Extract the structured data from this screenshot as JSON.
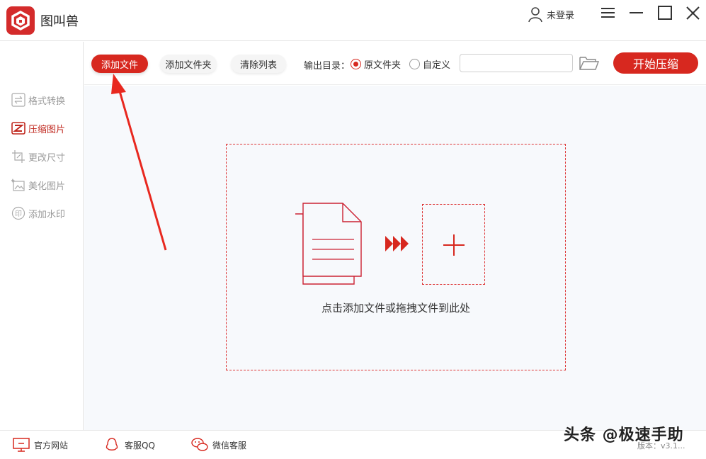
{
  "app": {
    "title": "图叫兽",
    "login_label": "未登录"
  },
  "sidebar": {
    "items": [
      {
        "label": "格式转换",
        "icon": "swap-icon",
        "active": false
      },
      {
        "label": "压缩图片",
        "icon": "compress-icon",
        "active": true
      },
      {
        "label": "更改尺寸",
        "icon": "crop-icon",
        "active": false
      },
      {
        "label": "美化图片",
        "icon": "magic-image-icon",
        "active": false
      },
      {
        "label": "添加水印",
        "icon": "stamp-icon",
        "active": false
      }
    ]
  },
  "toolbar": {
    "add_file": "添加文件",
    "add_folder": "添加文件夹",
    "clear_list": "清除列表",
    "output_label": "输出目录：",
    "radio_original": "原文件夹",
    "radio_custom": "自定义",
    "selected_output": "原文件夹",
    "path_value": "",
    "start_button": "开始压缩"
  },
  "main": {
    "drop_text": "点击添加文件或拖拽文件到此处"
  },
  "footer": {
    "website": "官方网站",
    "qq": "客服QQ",
    "wechat": "微信客服",
    "version": "版本：v3.1..."
  },
  "watermark": "头条 @极速手助",
  "colors": {
    "accent": "#d7281f",
    "main_bg": "#f7f9fc",
    "sidebar_inactive": "#9a9a9a"
  }
}
